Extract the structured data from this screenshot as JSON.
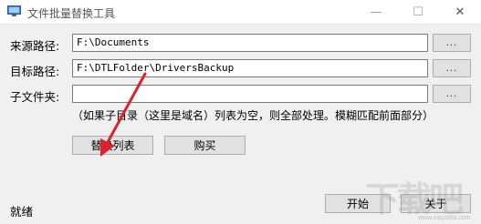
{
  "window": {
    "title": "文件批量替换工具",
    "minimize": "—",
    "maximize": "☐",
    "close": "✕"
  },
  "rows": {
    "source": {
      "label": "来源路径:",
      "value": "F:\\Documents",
      "browse": "..."
    },
    "target": {
      "label": "目标路径:",
      "value": "F:\\DTLFolder\\DriversBackup",
      "browse": "..."
    },
    "subfolder": {
      "label": "子文件夹:",
      "value": "",
      "browse": "..."
    }
  },
  "hint": "（如果子目录（这里是域名）列表为空，则全部处理。模糊匹配前面部分）",
  "buttons": {
    "replace_list": "替换列表",
    "buy": "购买",
    "start": "开始",
    "about": "关于"
  },
  "status": "就绪",
  "watermark": {
    "text": "下载吧",
    "url": "www.xiazaiba.com"
  },
  "colors": {
    "arrow": "#d9232d",
    "background": "#f0f0f0"
  }
}
